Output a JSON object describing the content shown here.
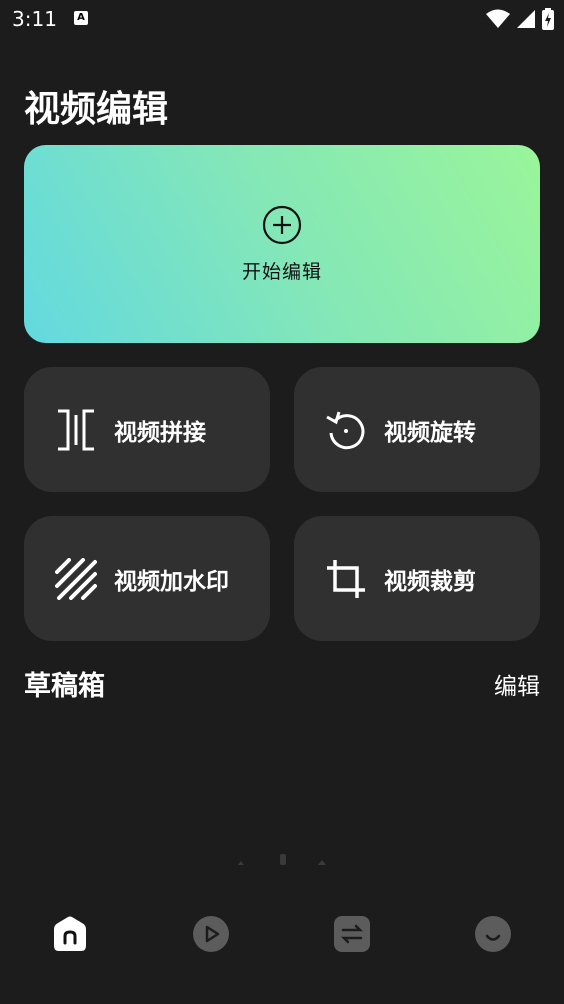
{
  "status_bar": {
    "time": "3:11",
    "notification_letter": "A"
  },
  "page": {
    "title": "视频编辑"
  },
  "hero": {
    "label": "开始编辑",
    "gradient": [
      "#63d9e0",
      "#86e8b4",
      "#9af59a"
    ]
  },
  "tools": [
    {
      "label": "视频拼接",
      "icon": "merge-icon"
    },
    {
      "label": "视频旋转",
      "icon": "rotate-icon"
    },
    {
      "label": "视频加水印",
      "icon": "watermark-icon"
    },
    {
      "label": "视频裁剪",
      "icon": "crop-icon"
    }
  ],
  "drafts": {
    "title": "草稿箱",
    "edit_label": "编辑"
  },
  "bottom_nav": [
    {
      "icon": "home-icon",
      "active": true
    },
    {
      "icon": "play-icon",
      "active": false
    },
    {
      "icon": "swap-icon",
      "active": false
    },
    {
      "icon": "smile-icon",
      "active": false
    }
  ],
  "colors": {
    "background": "#1c1c1c",
    "tile": "#303030",
    "nav_inactive": "#5c5c5c"
  }
}
